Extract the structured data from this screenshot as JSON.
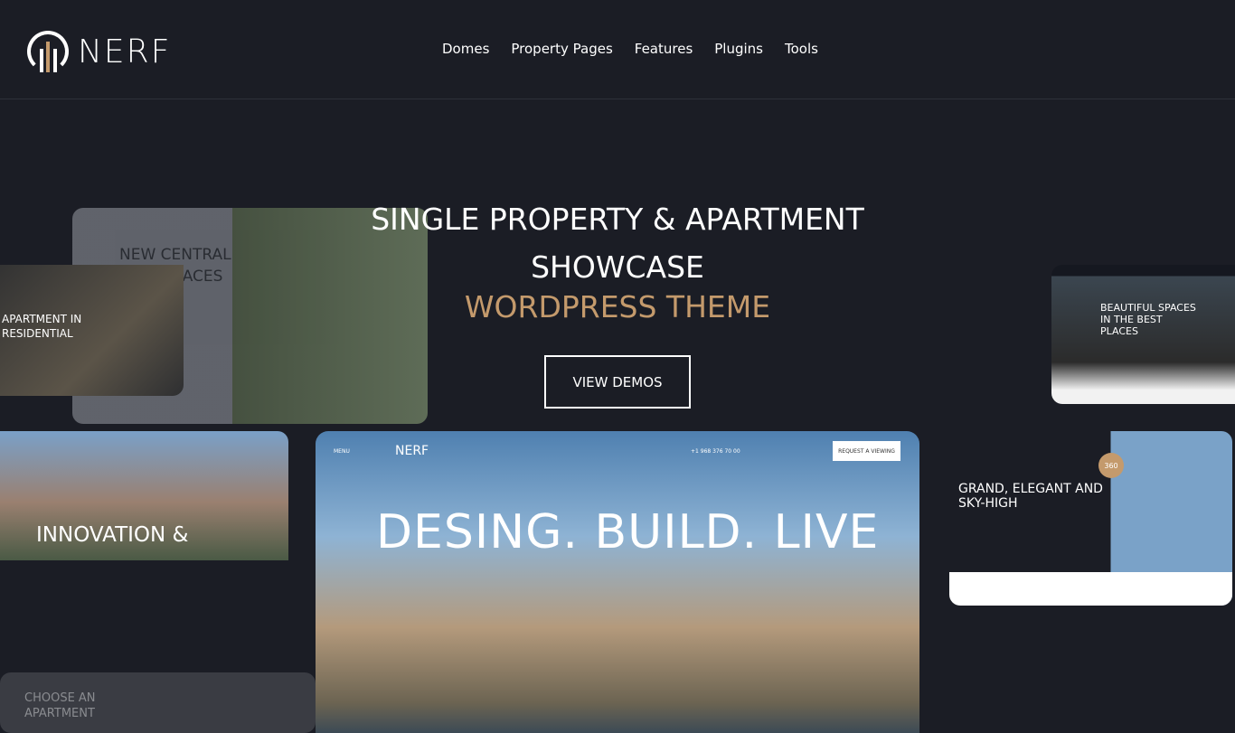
{
  "brand": {
    "name": "NERF",
    "accent": "#c49a6c"
  },
  "nav": [
    "Domes",
    "Property Pages",
    "Features",
    "Plugins",
    "Tools"
  ],
  "hero": {
    "line1": "SINGLE PROPERTY & APARTMENT",
    "line2": "SHOWCASE",
    "line3": "WORDPRESS THEME",
    "button": "VIEW DEMOS"
  },
  "previews": {
    "p1": "NEW CENTRAL VIEW PLACES",
    "p2": "APARTMENT IN RESIDENTIAL",
    "p3": "BEAUTIFUL SPACES IN THE BEST PLACES",
    "p4": "INNOVATION &",
    "p5": {
      "menu": "MENU",
      "logo": "NERF",
      "phone": "+1 968 376 70 00",
      "request": "REQUEST A VIEWING",
      "headline": "DESING. BUILD. LIVE"
    },
    "p6": {
      "headline": "GRAND, ELEGANT AND SKY-HIGH",
      "badge": "360"
    },
    "p7": "CHOOSE AN APARTMENT"
  }
}
